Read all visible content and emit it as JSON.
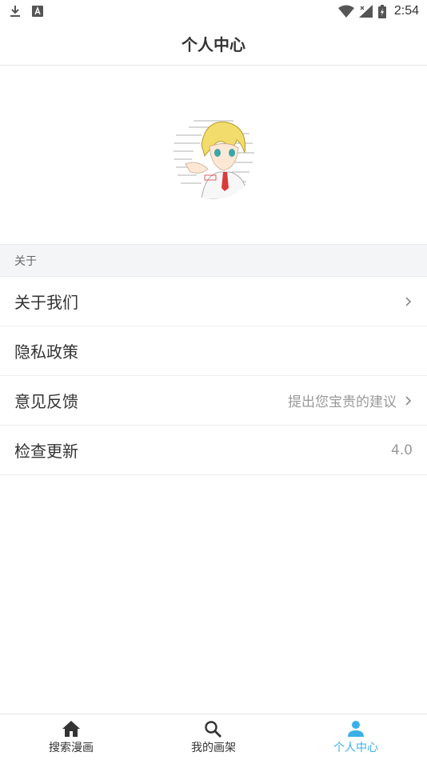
{
  "status_bar": {
    "time": "2:54",
    "icons": [
      "download-icon",
      "a-notification-icon",
      "wifi-icon",
      "signal-icon",
      "battery-icon"
    ]
  },
  "header": {
    "title": "个人中心"
  },
  "avatar": {
    "icon": "anime-avatar-image"
  },
  "about_section": {
    "title": "关于",
    "items": [
      {
        "label": "关于我们",
        "value": "",
        "has_chevron": true
      },
      {
        "label": "隐私政策",
        "value": "",
        "has_chevron": false
      },
      {
        "label": "意见反馈",
        "value": "提出您宝贵的建议",
        "has_chevron": true
      },
      {
        "label": "检查更新",
        "value": "4.0",
        "has_chevron": false
      }
    ]
  },
  "bottom_nav": {
    "items": [
      {
        "label": "搜索漫画",
        "icon": "home-icon",
        "active": false
      },
      {
        "label": "我的画架",
        "icon": "search-icon",
        "active": false
      },
      {
        "label": "个人中心",
        "icon": "person-icon",
        "active": true
      }
    ]
  },
  "colors": {
    "accent": "#3ab0e8",
    "text": "#333333",
    "muted": "#999999",
    "section_bg": "#f4f5f7"
  }
}
